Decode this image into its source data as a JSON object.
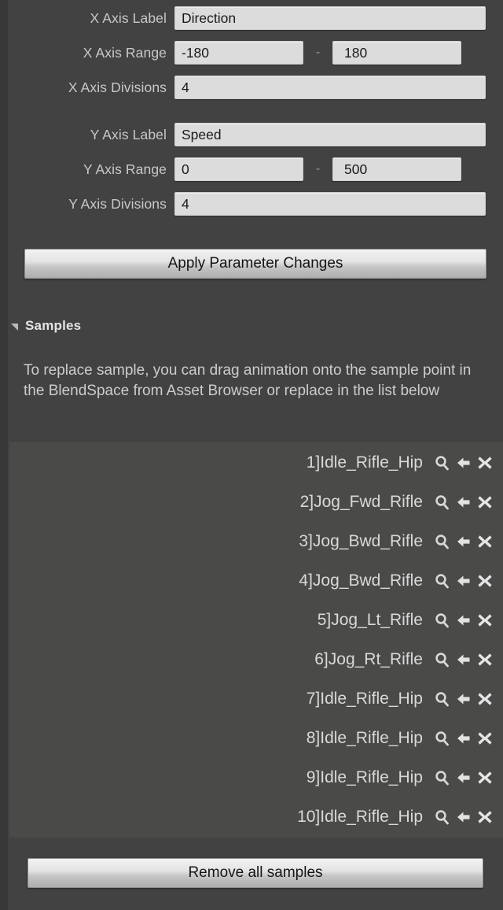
{
  "panel": {
    "properties": [
      {
        "label": "X Axis Label",
        "type": "text",
        "value": "Direction"
      },
      {
        "label": "X Axis Range",
        "type": "range",
        "min": "-180",
        "max": "180"
      },
      {
        "label": "X Axis Divisions",
        "type": "text",
        "value": "4"
      },
      {
        "label": "Y Axis Label",
        "type": "text",
        "value": "Speed"
      },
      {
        "label": "Y Axis Range",
        "type": "range",
        "min": "0",
        "max": "500"
      },
      {
        "label": "Y Axis Divisions",
        "type": "text",
        "value": "4"
      }
    ],
    "range_separator": "-",
    "apply_button_label": "Apply Parameter Changes"
  },
  "samples_section": {
    "header_label": "Samples",
    "expand_icon": "triangle-down-icon",
    "help_text": "To replace sample, you can drag animation onto the sample point in the BlendSpace from Asset Browser or replace in the list below",
    "row_icons": {
      "browse": "magnifier-icon",
      "replace": "arrow-left-icon",
      "remove": "close-x-icon"
    },
    "items": [
      {
        "index": "1]",
        "name": "Idle_Rifle_Hip"
      },
      {
        "index": "2]",
        "name": "Jog_Fwd_Rifle"
      },
      {
        "index": "3]",
        "name": "Jog_Bwd_Rifle"
      },
      {
        "index": "4]",
        "name": "Jog_Bwd_Rifle"
      },
      {
        "index": "5]",
        "name": "Jog_Lt_Rifle"
      },
      {
        "index": "6]",
        "name": "Jog_Rt_Rifle"
      },
      {
        "index": "7]",
        "name": "Idle_Rifle_Hip"
      },
      {
        "index": "8]",
        "name": "Idle_Rifle_Hip"
      },
      {
        "index": "9]",
        "name": "Idle_Rifle_Hip"
      },
      {
        "index": "10]",
        "name": "Idle_Rifle_Hip"
      }
    ],
    "remove_all_button_label": "Remove all samples"
  },
  "colors": {
    "panel_background": "#424242",
    "list_background": "#4a4a48",
    "field_background": "#dcdcdc",
    "label_text": "#c8c8c8",
    "value_text": "#1a1a1a",
    "list_text": "#d9d9d9"
  }
}
